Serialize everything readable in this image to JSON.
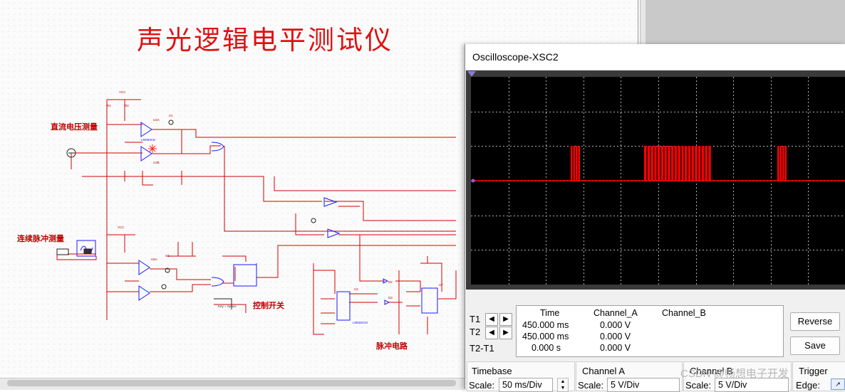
{
  "schematic": {
    "title": "声光逻辑电平测试仪",
    "labels": {
      "dc_voltage": "直流电压测量",
      "pulse": "连续脉冲测量",
      "control_switch": "控制开关",
      "pulse_circuit": "脉冲电路"
    },
    "components": {
      "vcc": "VCC",
      "u3a": "U3A",
      "u3b": "U3B",
      "u5a": "U5A",
      "u2": "U2",
      "u7": "U7",
      "x1": "X1",
      "x2": "X2",
      "r1": "R1",
      "r2": "R2",
      "lm393": "LM393AD",
      "ne555": "LM555CM",
      "d2": "D2",
      "d3": "D3",
      "key": "Key = Space"
    }
  },
  "oscilloscope": {
    "title": "Oscilloscope-XSC2",
    "trace_color": "#ff0000",
    "grid_color": "#b0b0b0",
    "cursors": {
      "t1_label": "T1",
      "t2_label": "T2",
      "diff_label": "T2-T1",
      "left_arrow": "◀",
      "right_arrow": "▶"
    },
    "readout": {
      "headers": [
        "Time",
        "Channel_A",
        "Channel_B"
      ],
      "rows": [
        [
          "450.000 ms",
          "0.000 V",
          ""
        ],
        [
          "450.000 ms",
          "0.000 V",
          ""
        ],
        [
          "0.000 s",
          "0.000 V",
          ""
        ]
      ]
    },
    "buttons": {
      "reverse": "Reverse",
      "save": "Save"
    },
    "timebase": {
      "title": "Timebase",
      "scale_label": "Scale:",
      "scale_value": "50 ms/Div"
    },
    "channel_a": {
      "title": "Channel A",
      "scale_label": "Scale:",
      "scale_value": "5  V/Div"
    },
    "channel_b": {
      "title": "Channel B",
      "scale_label": "Scale:",
      "scale_value": "5  V/Div"
    },
    "trigger": {
      "title": "Trigger",
      "edge_label": "Edge:"
    }
  },
  "watermark": "CSDN @畅想电子开发"
}
